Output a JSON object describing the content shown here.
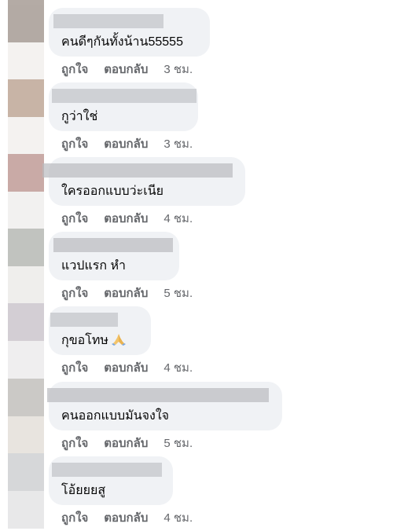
{
  "comments": [
    {
      "text": "คนดีๆกันทั้งน้าน55555",
      "like": "ถูกใจ",
      "reply": "ตอบกลับ",
      "time": "3 ชม.",
      "avatar": [
        "#b3aaa4",
        "#f4f2f0"
      ]
    },
    {
      "text": "กูว่าใช่",
      "like": "ถูกใจ",
      "reply": "ตอบกลับ",
      "time": "3 ชม.",
      "avatar": [
        "#c8b4a6",
        "#f4f2f0"
      ]
    },
    {
      "text": "ใครออกแบบว่ะเนีย",
      "like": "ถูกใจ",
      "reply": "ตอบกลับ",
      "time": "4 ชม.",
      "avatar": [
        "#c9aaa6",
        "#f2f1f0"
      ]
    },
    {
      "text": "แวปแรก หำ",
      "like": "ถูกใจ",
      "reply": "ตอบกลับ",
      "time": "5 ชม.",
      "avatar": [
        "#c1c3bf",
        "#efeeec"
      ]
    },
    {
      "text": "กุขอโทษ",
      "emoji": "folded-hands-icon",
      "like": "ถูกใจ",
      "reply": "ตอบกลับ",
      "time": "4 ชม.",
      "avatar": [
        "#d3ced4",
        "#efeeef"
      ]
    },
    {
      "text": "คนออกแบบมันจงใจ",
      "like": "ถูกใจ",
      "reply": "ตอบกลับ",
      "time": "5 ชม.",
      "avatar": [
        "#cbc9c6",
        "#e8e4df"
      ]
    },
    {
      "text": "โอ้ยยยสู",
      "like": "ถูกใจ",
      "reply": "ตอบกลับ",
      "time": "4 ชม.",
      "avatar": [
        "#d6d7d9",
        "#e8e8e9"
      ]
    }
  ]
}
